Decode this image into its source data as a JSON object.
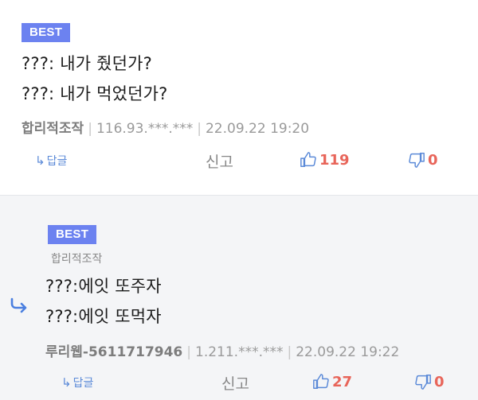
{
  "comments": [
    {
      "badge": "BEST",
      "lines": [
        "???: 내가 줬던가?",
        "???: 내가 먹었던가?"
      ],
      "author": "합리적조작",
      "ip": "116.93.***.***",
      "date": "22.09.22 19:20",
      "reply_label": "답글",
      "report_label": "신고",
      "likes": "119",
      "dislikes": "0"
    },
    {
      "badge": "BEST",
      "reply_to": "합리적조작",
      "lines": [
        "???:에잇 또주자",
        "???:에잇 또먹자"
      ],
      "author": "루리웹-5611717946",
      "ip": "1.211.***.***",
      "date": "22.09.22 19:22",
      "reply_label": "답글",
      "report_label": "신고",
      "likes": "27",
      "dislikes": "0"
    }
  ],
  "icons": {
    "reply_arrow": "reply-arrow-icon",
    "like": "thumbs-up-icon",
    "dislike": "thumbs-down-icon",
    "reply_indicator": "reply-indicator-arrow-icon"
  },
  "colors": {
    "badge": "#6c82f0",
    "accent_blue": "#5b8ad8",
    "vote_red": "#e8655a",
    "reply_bg": "#f4f5f7"
  }
}
